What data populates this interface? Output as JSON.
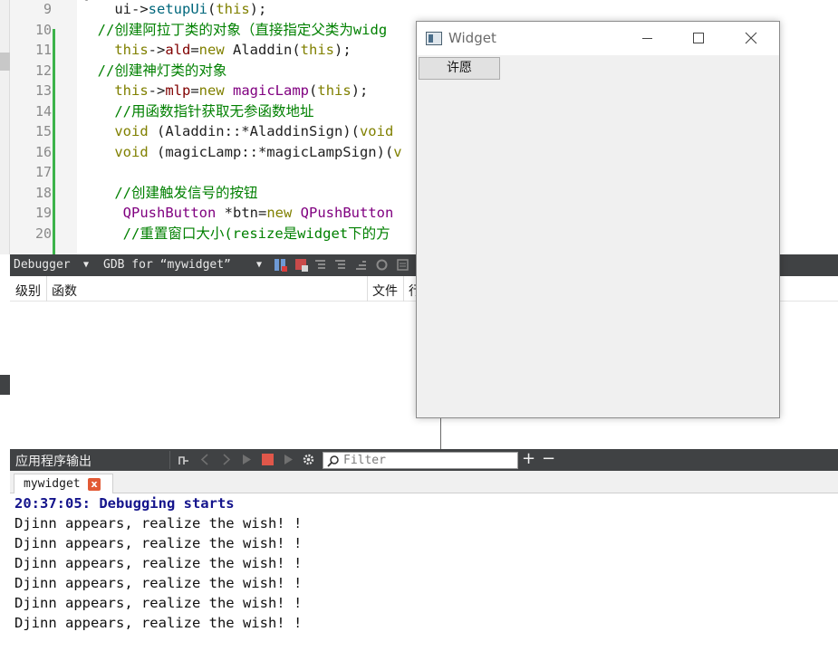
{
  "editor": {
    "line_numbers": [
      "9",
      "10",
      "11",
      "12",
      "13",
      "14",
      "15",
      "16",
      "17",
      "18",
      "19",
      "20"
    ],
    "lines": [
      [
        {
          "t": "    ui->",
          "c": ""
        },
        {
          "t": "setupUi",
          "c": "fn"
        },
        {
          "t": "(",
          "c": ""
        },
        {
          "t": "this",
          "c": "kw"
        },
        {
          "t": ");",
          "c": ""
        }
      ],
      [
        {
          "t": "  //创建阿拉丁类的对象（直接指定父类为widg",
          "c": "cm"
        }
      ],
      [
        {
          "t": "    ",
          "c": ""
        },
        {
          "t": "this",
          "c": "kw"
        },
        {
          "t": "->",
          "c": ""
        },
        {
          "t": "ald",
          "c": "vr"
        },
        {
          "t": "=",
          "c": ""
        },
        {
          "t": "new",
          "c": "kw"
        },
        {
          "t": " Aladdin(",
          "c": ""
        },
        {
          "t": "this",
          "c": "kw"
        },
        {
          "t": ");",
          "c": ""
        }
      ],
      [
        {
          "t": "  //创建神灯类的对象",
          "c": "cm"
        }
      ],
      [
        {
          "t": "    ",
          "c": ""
        },
        {
          "t": "this",
          "c": "kw"
        },
        {
          "t": "->",
          "c": ""
        },
        {
          "t": "mlp",
          "c": "vr"
        },
        {
          "t": "=",
          "c": ""
        },
        {
          "t": "new",
          "c": "kw"
        },
        {
          "t": " ",
          "c": ""
        },
        {
          "t": "magicLamp",
          "c": "ty"
        },
        {
          "t": "(",
          "c": ""
        },
        {
          "t": "this",
          "c": "kw"
        },
        {
          "t": ");",
          "c": ""
        }
      ],
      [
        {
          "t": "    //用函数指针获取无参函数地址",
          "c": "cm"
        }
      ],
      [
        {
          "t": "    ",
          "c": ""
        },
        {
          "t": "void",
          "c": "kw"
        },
        {
          "t": " (Aladdin::*AladdinSign)(",
          "c": ""
        },
        {
          "t": "void",
          "c": "kw"
        }
      ],
      [
        {
          "t": "    ",
          "c": ""
        },
        {
          "t": "void",
          "c": "kw"
        },
        {
          "t": " (magicLamp::*magicLampSign)(",
          "c": ""
        },
        {
          "t": "v",
          "c": "kw"
        }
      ],
      [
        {
          "t": "",
          "c": ""
        }
      ],
      [
        {
          "t": "    //创建触发信号的按钮",
          "c": "cm"
        }
      ],
      [
        {
          "t": "     ",
          "c": ""
        },
        {
          "t": "QPushButton",
          "c": "ty"
        },
        {
          "t": " *btn=",
          "c": ""
        },
        {
          "t": "new",
          "c": "kw"
        },
        {
          "t": " ",
          "c": ""
        },
        {
          "t": "QPushButton",
          "c": "ty"
        }
      ],
      [
        {
          "t": "     //重置窗口大小(resize是widget下的方",
          "c": "cm"
        }
      ]
    ]
  },
  "debugger_toolbar": {
    "debugger_label": "Debugger",
    "engine_label": "GDB for “mywidget”"
  },
  "stack_panel": {
    "columns": [
      "级别",
      "函数",
      "文件",
      "行"
    ]
  },
  "output_toolbar": {
    "title": "应用程序输出",
    "filter_placeholder": "Filter",
    "add_label": "+",
    "remove_label": "−"
  },
  "output": {
    "tab_label": "mywidget",
    "tab_close": "x",
    "header": "20:37:05: Debugging starts",
    "lines": [
      "Djinn appears, realize the wish! !",
      "Djinn appears, realize the wish! !",
      "Djinn appears, realize the wish! !",
      "Djinn appears, realize the wish! !",
      "Djinn appears, realize the wish! !",
      "Djinn appears, realize the wish! !"
    ]
  },
  "widget_window": {
    "title": "Widget",
    "button_label": "许愿",
    "controls": [
      "minimize-icon",
      "maximize-icon",
      "close-icon"
    ]
  },
  "colors": {
    "keyword": "#808000",
    "function": "#00677c",
    "type": "#800080",
    "comment": "#008000",
    "member": "#800000",
    "panel_bar": "#404244",
    "change_bar": "#3cb34a",
    "output_header": "#14148c"
  }
}
